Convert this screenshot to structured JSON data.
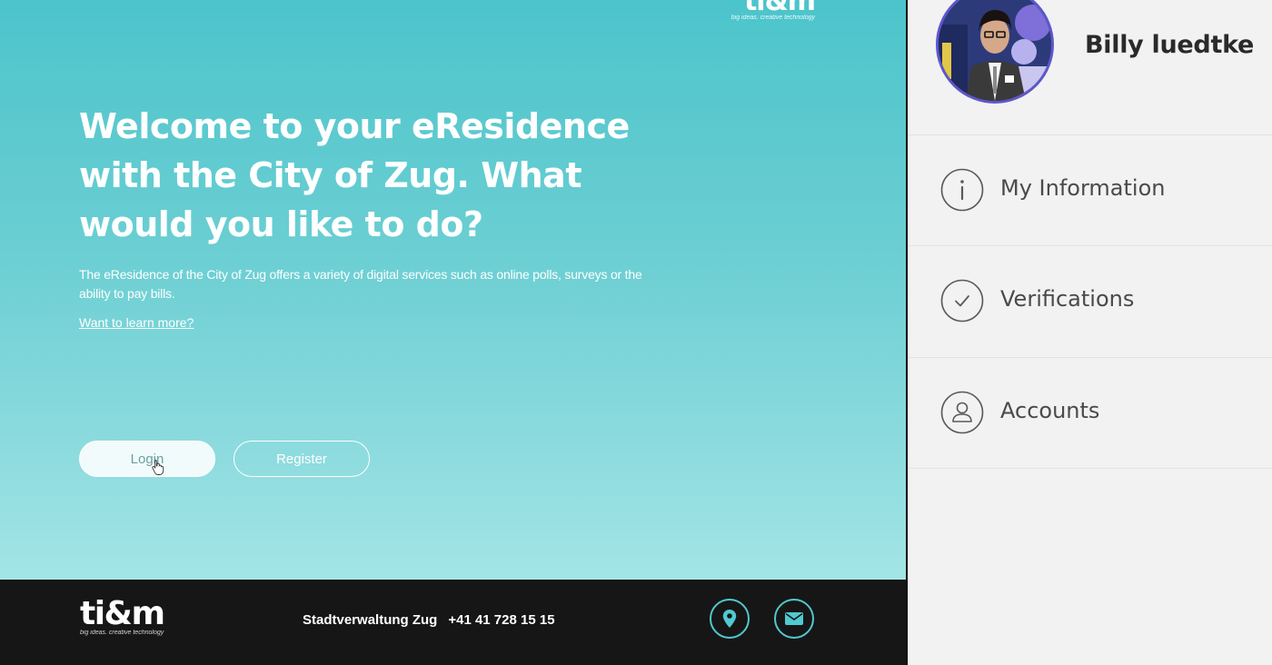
{
  "web": {
    "top_logo": {
      "mark": "ti&m",
      "tagline": "big ideas. creative technology"
    },
    "hero": {
      "title": "Welcome to your eResidence with the City of Zug. What would you like to do?",
      "description": "The eResidence of the City of Zug offers a variety of digital services such as online polls, surveys or the ability to pay bills.",
      "learn_more": "Want to learn more?"
    },
    "buttons": {
      "login": "Login",
      "register": "Register"
    }
  },
  "footer": {
    "logo": {
      "mark": "ti&m",
      "tagline": "big ideas. creative technology"
    },
    "org": "Stadtverwaltung Zug",
    "phone": "+41 41 728 15 15",
    "icons": {
      "map": "map-pin-icon",
      "mail": "mail-icon"
    },
    "accent_color": "#50c9cf"
  },
  "panel": {
    "user_name": "Billy luedtke",
    "avatar_border_color": "#5e57c9",
    "menu": [
      {
        "label": "My Information",
        "icon": "info-icon"
      },
      {
        "label": "Verifications",
        "icon": "check-icon"
      },
      {
        "label": "Accounts",
        "icon": "user-icon"
      }
    ]
  },
  "colors": {
    "hero_gradient_top": "#4cc4cb",
    "hero_gradient_bottom": "#a3e5e6",
    "footer_bg": "#161616",
    "panel_bg": "#f2f2f2"
  }
}
